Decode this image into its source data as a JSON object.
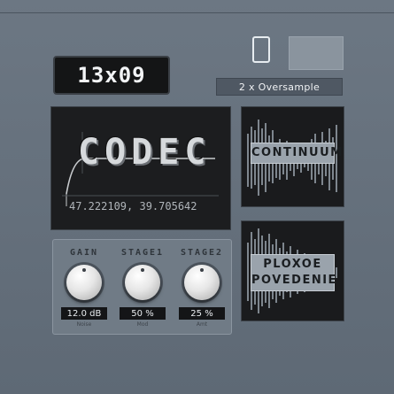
{
  "preset": {
    "name": "13x09"
  },
  "oversample": {
    "label": "2 x Oversample"
  },
  "toggle": {
    "icon": "toggle-icon"
  },
  "codec": {
    "title": "CODEC",
    "coordinates": "47.222109, 39.705642"
  },
  "tiles": {
    "continuum": {
      "label": "CONTINUUM"
    },
    "ploxoe": {
      "label_line1": "PLOXOE",
      "label_line2": "POVEDENIE"
    }
  },
  "knobs": [
    {
      "label": "GAIN",
      "value": "12.0 dB",
      "sub": "Noise"
    },
    {
      "label": "STAGE1",
      "value": "50 %",
      "sub": "Mod"
    },
    {
      "label": "STAGE2",
      "value": "25 %",
      "sub": "Amt"
    }
  ],
  "colors": {
    "background": "#66717d",
    "display": "#1c1d1f",
    "label_plate": "#9aa3ac",
    "knob": "#e6e6e6"
  }
}
